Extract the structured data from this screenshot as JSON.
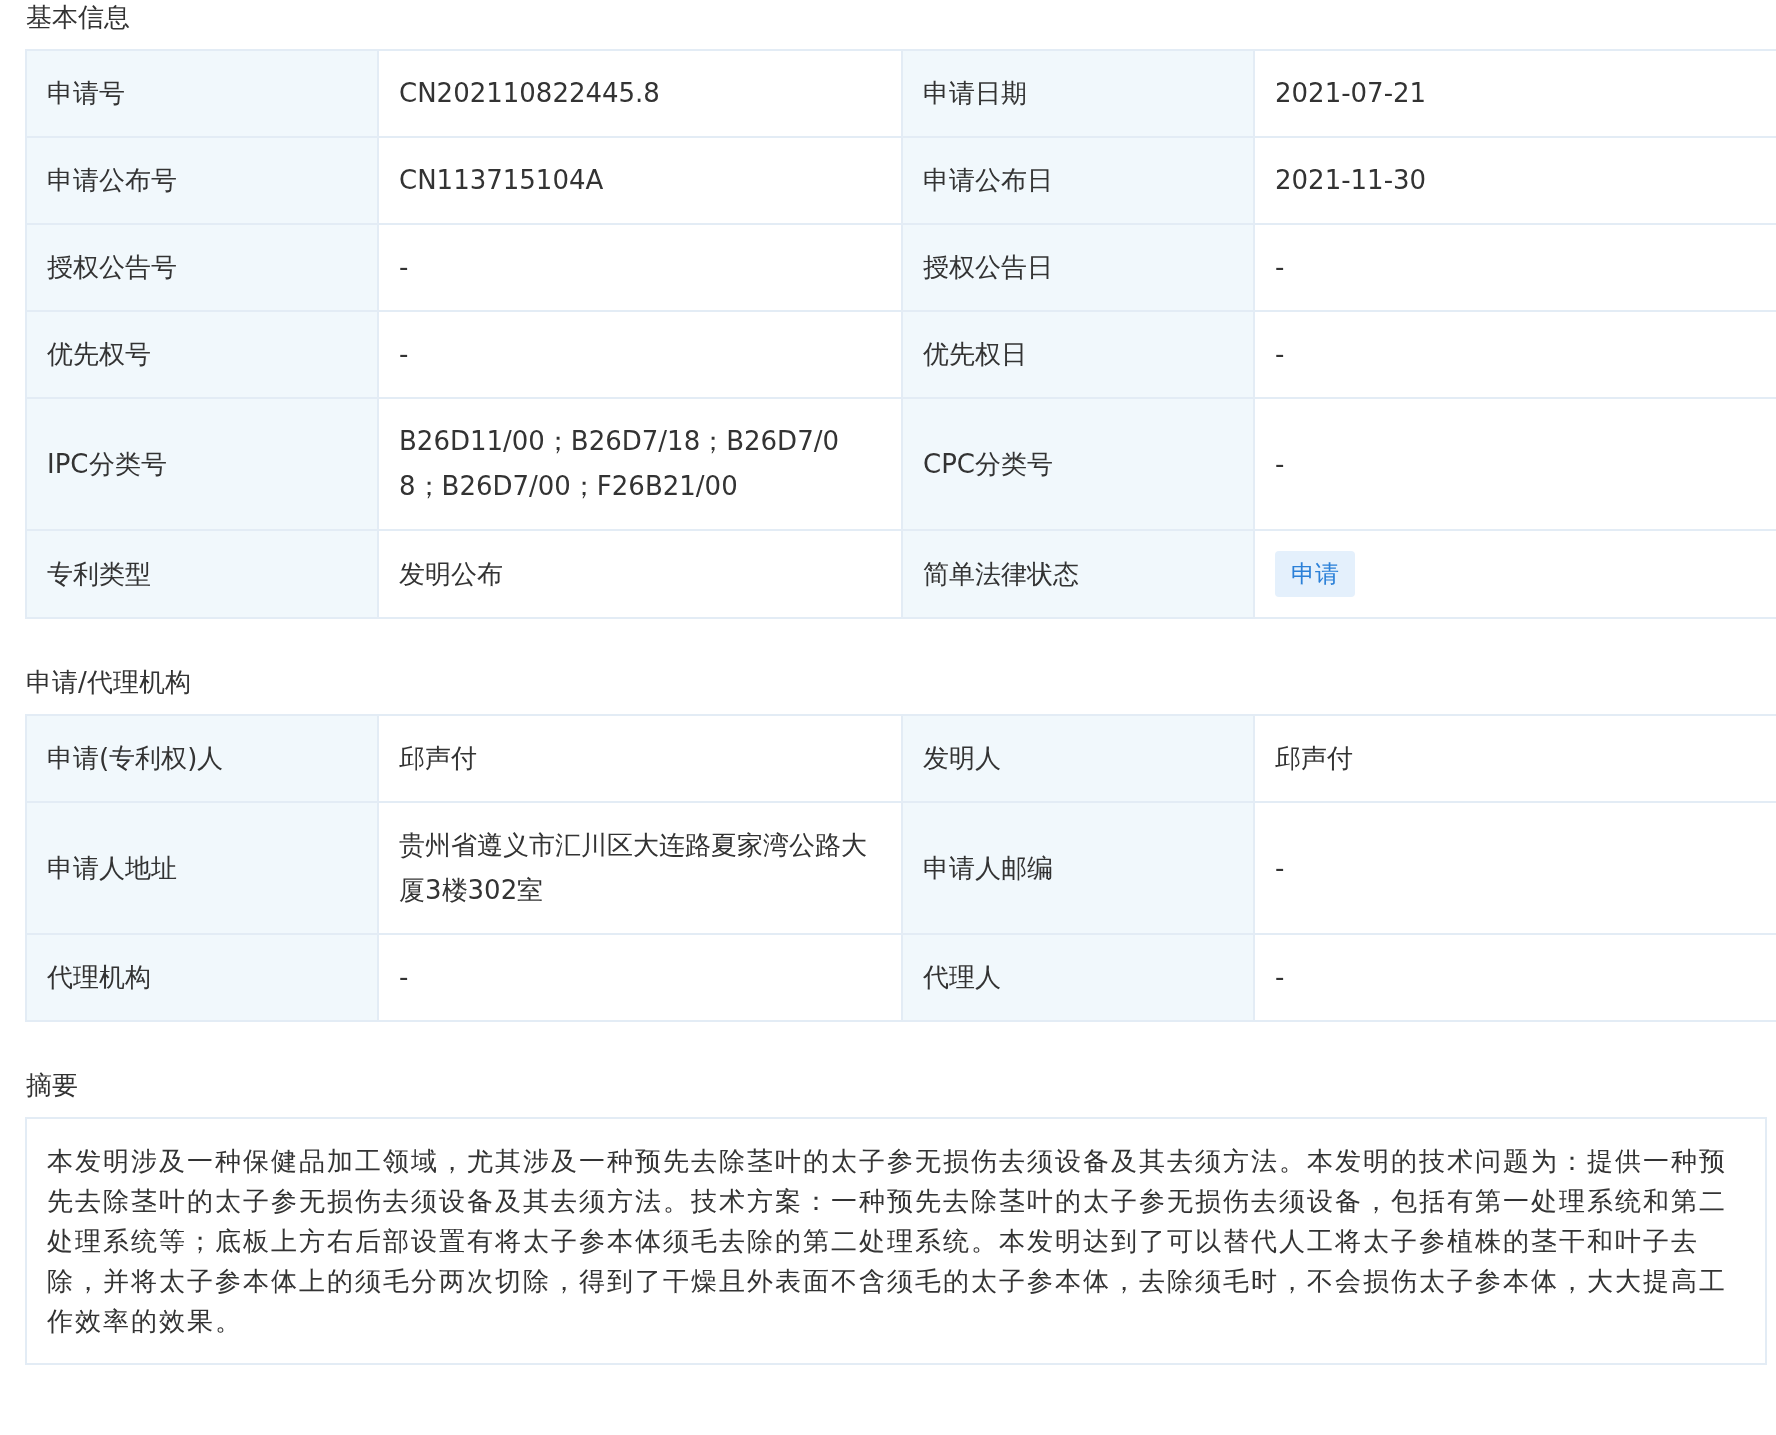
{
  "sections": [
    {
      "title": "基本信息",
      "kind": "fields",
      "rows": [
        {
          "cells": [
            {
              "label": "申请号",
              "value": "CN202110822445.8",
              "kind": "text"
            },
            {
              "label": "申请日期",
              "value": "2021-07-21",
              "kind": "text"
            }
          ]
        },
        {
          "cells": [
            {
              "label": "申请公布号",
              "value": "CN113715104A",
              "kind": "text"
            },
            {
              "label": "申请公布日",
              "value": "2021-11-30",
              "kind": "text"
            }
          ]
        },
        {
          "cells": [
            {
              "label": "授权公告号",
              "value": "-",
              "kind": "text"
            },
            {
              "label": "授权公告日",
              "value": "-",
              "kind": "text"
            }
          ]
        },
        {
          "cells": [
            {
              "label": "优先权号",
              "value": "-",
              "kind": "text"
            },
            {
              "label": "优先权日",
              "value": "-",
              "kind": "text"
            }
          ]
        },
        {
          "cells": [
            {
              "label": "IPC分类号",
              "value": "B26D11/00；B26D7/18；B26D7/08；B26D7/00；F26B21/00",
              "kind": "text"
            },
            {
              "label": "CPC分类号",
              "value": "-",
              "kind": "text"
            }
          ]
        },
        {
          "cells": [
            {
              "label": "专利类型",
              "value": "发明公布",
              "kind": "text"
            },
            {
              "label": "简单法律状态",
              "value": "申请",
              "kind": "tag"
            }
          ]
        }
      ]
    },
    {
      "title": "申请/代理机构",
      "kind": "fields",
      "rows": [
        {
          "cells": [
            {
              "label": "申请(专利权)人",
              "value": "邱声付",
              "kind": "text"
            },
            {
              "label": "发明人",
              "value": "邱声付",
              "kind": "text"
            }
          ]
        },
        {
          "cells": [
            {
              "label": "申请人地址",
              "value": "贵州省遵义市汇川区大连路夏家湾公路大厦3楼302室",
              "kind": "text"
            },
            {
              "label": "申请人邮编",
              "value": "-",
              "kind": "text"
            }
          ]
        },
        {
          "cells": [
            {
              "label": "代理机构",
              "value": "-",
              "kind": "text"
            },
            {
              "label": "代理人",
              "value": "-",
              "kind": "text"
            }
          ]
        }
      ]
    },
    {
      "title": "摘要",
      "kind": "text",
      "text": "本发明涉及一种保健品加工领域，尤其涉及一种预先去除茎叶的太子参无损伤去须设备及其去须方法。本发明的技术问题为：提供一种预先去除茎叶的太子参无损伤去须设备及其去须方法。技术方案：一种预先去除茎叶的太子参无损伤去须设备，包括有第一处理系统和第二处理系统等；底板上方右后部设置有将太子参本体须毛去除的第二处理系统。本发明达到了可以替代人工将太子参植株的茎干和叶子去除，并将太子参本体上的须毛分两次切除，得到了干燥且外表面不含须毛的太子参本体，去除须毛时，不会损伤太子参本体，大大提高工作效率的效果。"
    }
  ]
}
